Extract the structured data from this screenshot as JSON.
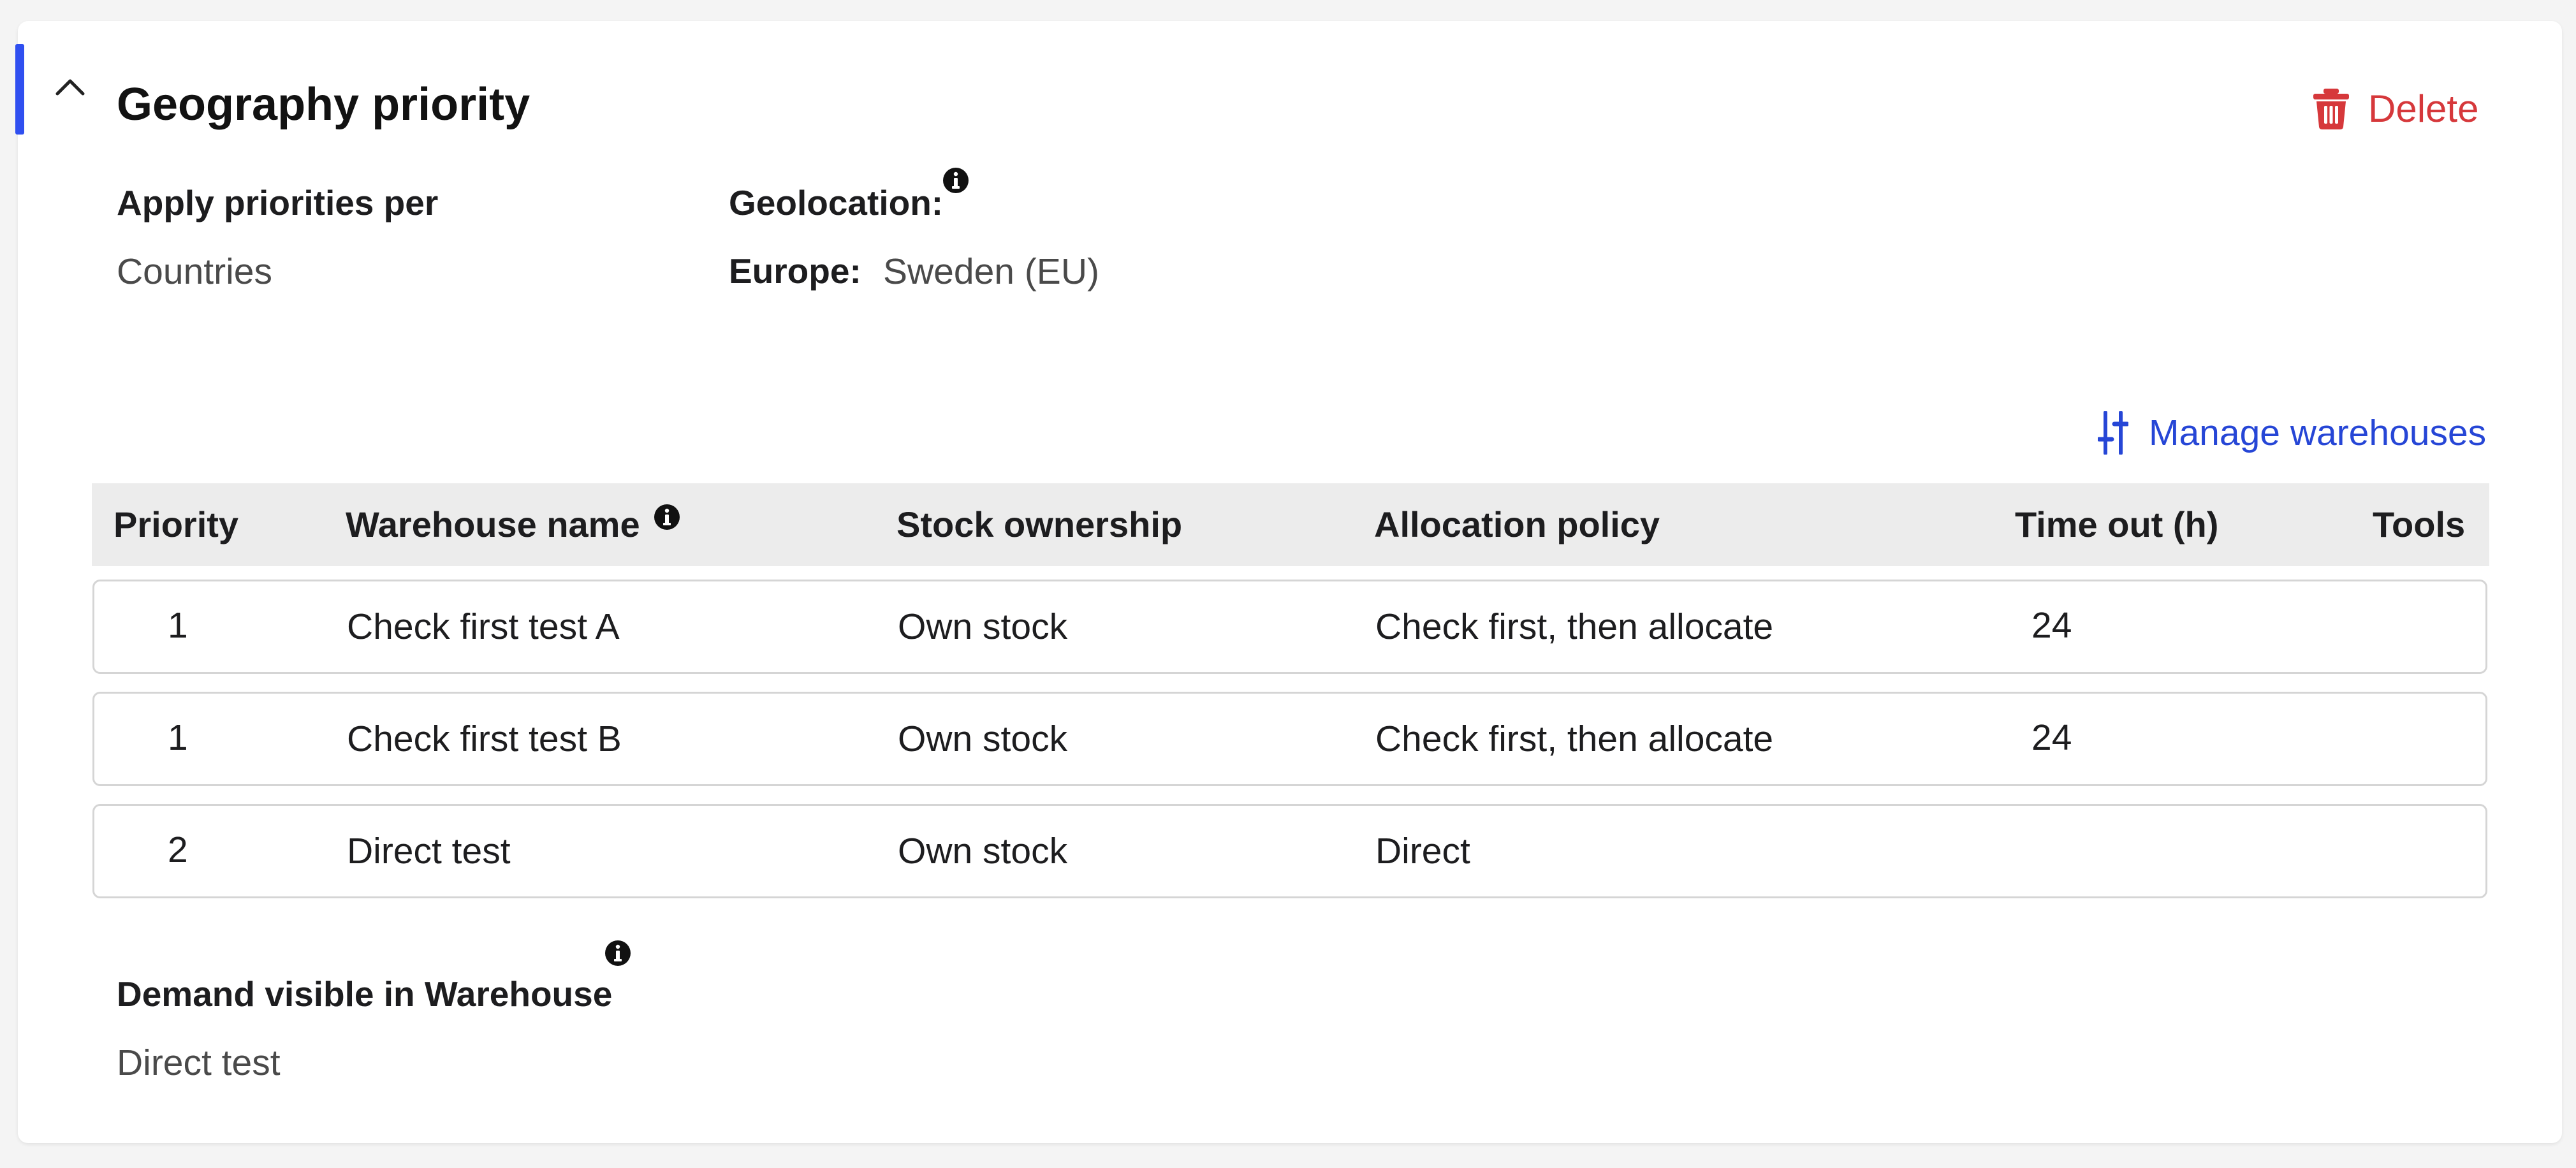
{
  "section": {
    "title": "Geography priority",
    "delete_label": "Delete"
  },
  "apply_priorities": {
    "label": "Apply priorities per",
    "value": "Countries"
  },
  "geolocation": {
    "label": "Geolocation:",
    "region_label": "Europe:",
    "region_value": "Sweden (EU)"
  },
  "manage_warehouses_label": "Manage warehouses",
  "table": {
    "headers": {
      "priority": "Priority",
      "warehouse_name": "Warehouse name",
      "stock_ownership": "Stock ownership",
      "allocation_policy": "Allocation policy",
      "time_out": "Time out (h)",
      "tools": "Tools"
    },
    "rows": [
      {
        "priority": "1",
        "warehouse_name": "Check first test A",
        "stock_ownership": "Own stock",
        "allocation_policy": "Check first, then allocate",
        "time_out": "24",
        "tools": ""
      },
      {
        "priority": "1",
        "warehouse_name": "Check first test B",
        "stock_ownership": "Own stock",
        "allocation_policy": "Check first, then allocate",
        "time_out": "24",
        "tools": ""
      },
      {
        "priority": "2",
        "warehouse_name": "Direct test",
        "stock_ownership": "Own stock",
        "allocation_policy": "Direct",
        "time_out": "",
        "tools": ""
      }
    ]
  },
  "demand_visible": {
    "label": "Demand visible in Warehouse",
    "value": "Direct test"
  },
  "icons": {
    "collapse": "chevron-up-icon",
    "delete": "trash-icon",
    "info": "info-icon",
    "manage": "sliders-icon"
  },
  "colors": {
    "accent": "#2f4ff0",
    "danger": "#d6383b",
    "link": "#2646d6"
  }
}
